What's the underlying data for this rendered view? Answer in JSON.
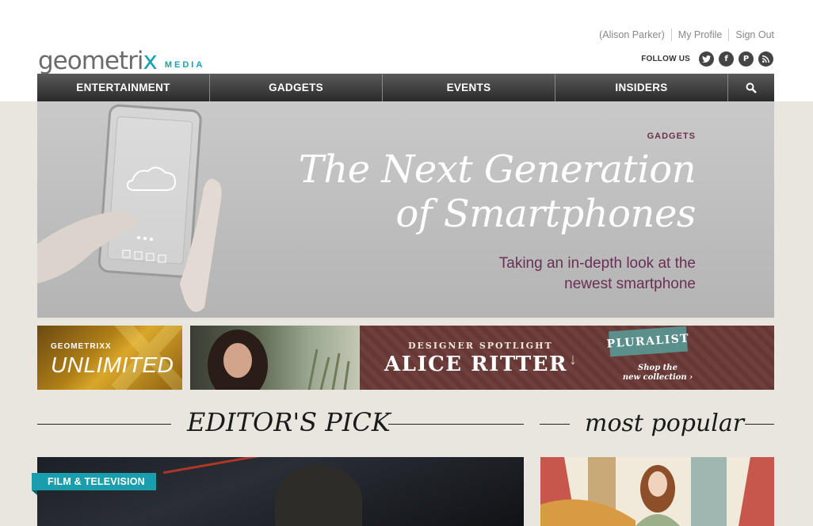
{
  "brand": {
    "name_main": "geometri",
    "name_x": "x",
    "name_sub": "MEDIA"
  },
  "user_links": [
    "(Alison Parker)",
    "My Profile",
    "Sign Out"
  ],
  "follow": {
    "label": "FOLLOW US",
    "icons": [
      "twitter-icon",
      "facebook-icon",
      "pinterest-icon",
      "rss-icon"
    ]
  },
  "nav": {
    "items": [
      "ENTERTAINMENT",
      "GADGETS",
      "EVENTS",
      "INSIDERS"
    ],
    "search_icon": "search-icon"
  },
  "hero": {
    "category": "GADGETS",
    "title_line1": "The Next Generation",
    "title_line2": "of Smartphones",
    "subtitle_line1": "Taking an in-depth look at the",
    "subtitle_line2": "newest smartphone"
  },
  "banner_unlimited": {
    "small": "GEOMETRIXX",
    "big": "UNLIMITED"
  },
  "banner_spotlight": {
    "small": "DESIGNER SPOTLIGHT",
    "big": "ALICE RITTER",
    "brand_tag": "PLURALIST",
    "cta_line1": "Shop the",
    "cta_line2": "new collection ›"
  },
  "sections": {
    "editors_pick": "EDITOR'S PICK",
    "most_popular": "most popular"
  },
  "editors_card": {
    "tag": "FILM & TELEVISION"
  },
  "colors": {
    "accent": "#1aa0b3",
    "nav_dark": "#2a2a2a",
    "hero_purple": "#6a2f55",
    "page_bg": "#e8e6df"
  }
}
